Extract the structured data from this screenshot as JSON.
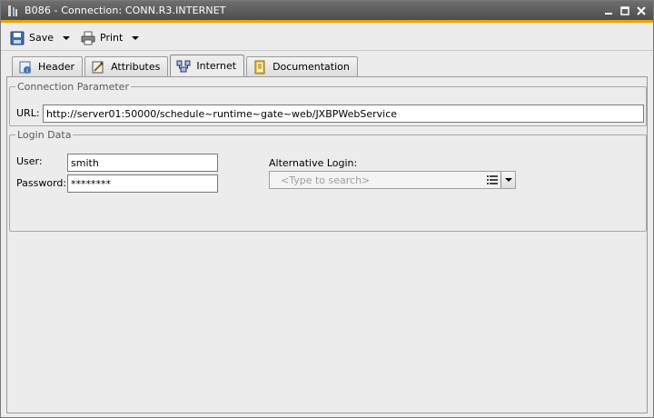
{
  "window": {
    "title": "B086 - Connection: CONN.R3.INTERNET"
  },
  "toolbar": {
    "save_label": "Save",
    "print_label": "Print"
  },
  "tabs": [
    {
      "label": "Header",
      "icon": "header-icon"
    },
    {
      "label": "Attributes",
      "icon": "attributes-icon"
    },
    {
      "label": "Internet",
      "icon": "internet-icon",
      "active": true
    },
    {
      "label": "Documentation",
      "icon": "documentation-icon"
    }
  ],
  "connection": {
    "legend": "Connection Parameter",
    "url_label": "URL:",
    "url_value": "http://server01:50000/schedule~runtime~gate~web/JXBPWebService"
  },
  "login": {
    "legend": "Login Data",
    "user_label": "User:",
    "user_value": "smith",
    "password_label": "Password:",
    "password_value": "********",
    "alt_label": "Alternative Login:",
    "alt_placeholder": "<Type to search>"
  },
  "colors": {
    "titlebar_accent": "#e8a400",
    "titlebar_bg": "#5a5a5a"
  }
}
